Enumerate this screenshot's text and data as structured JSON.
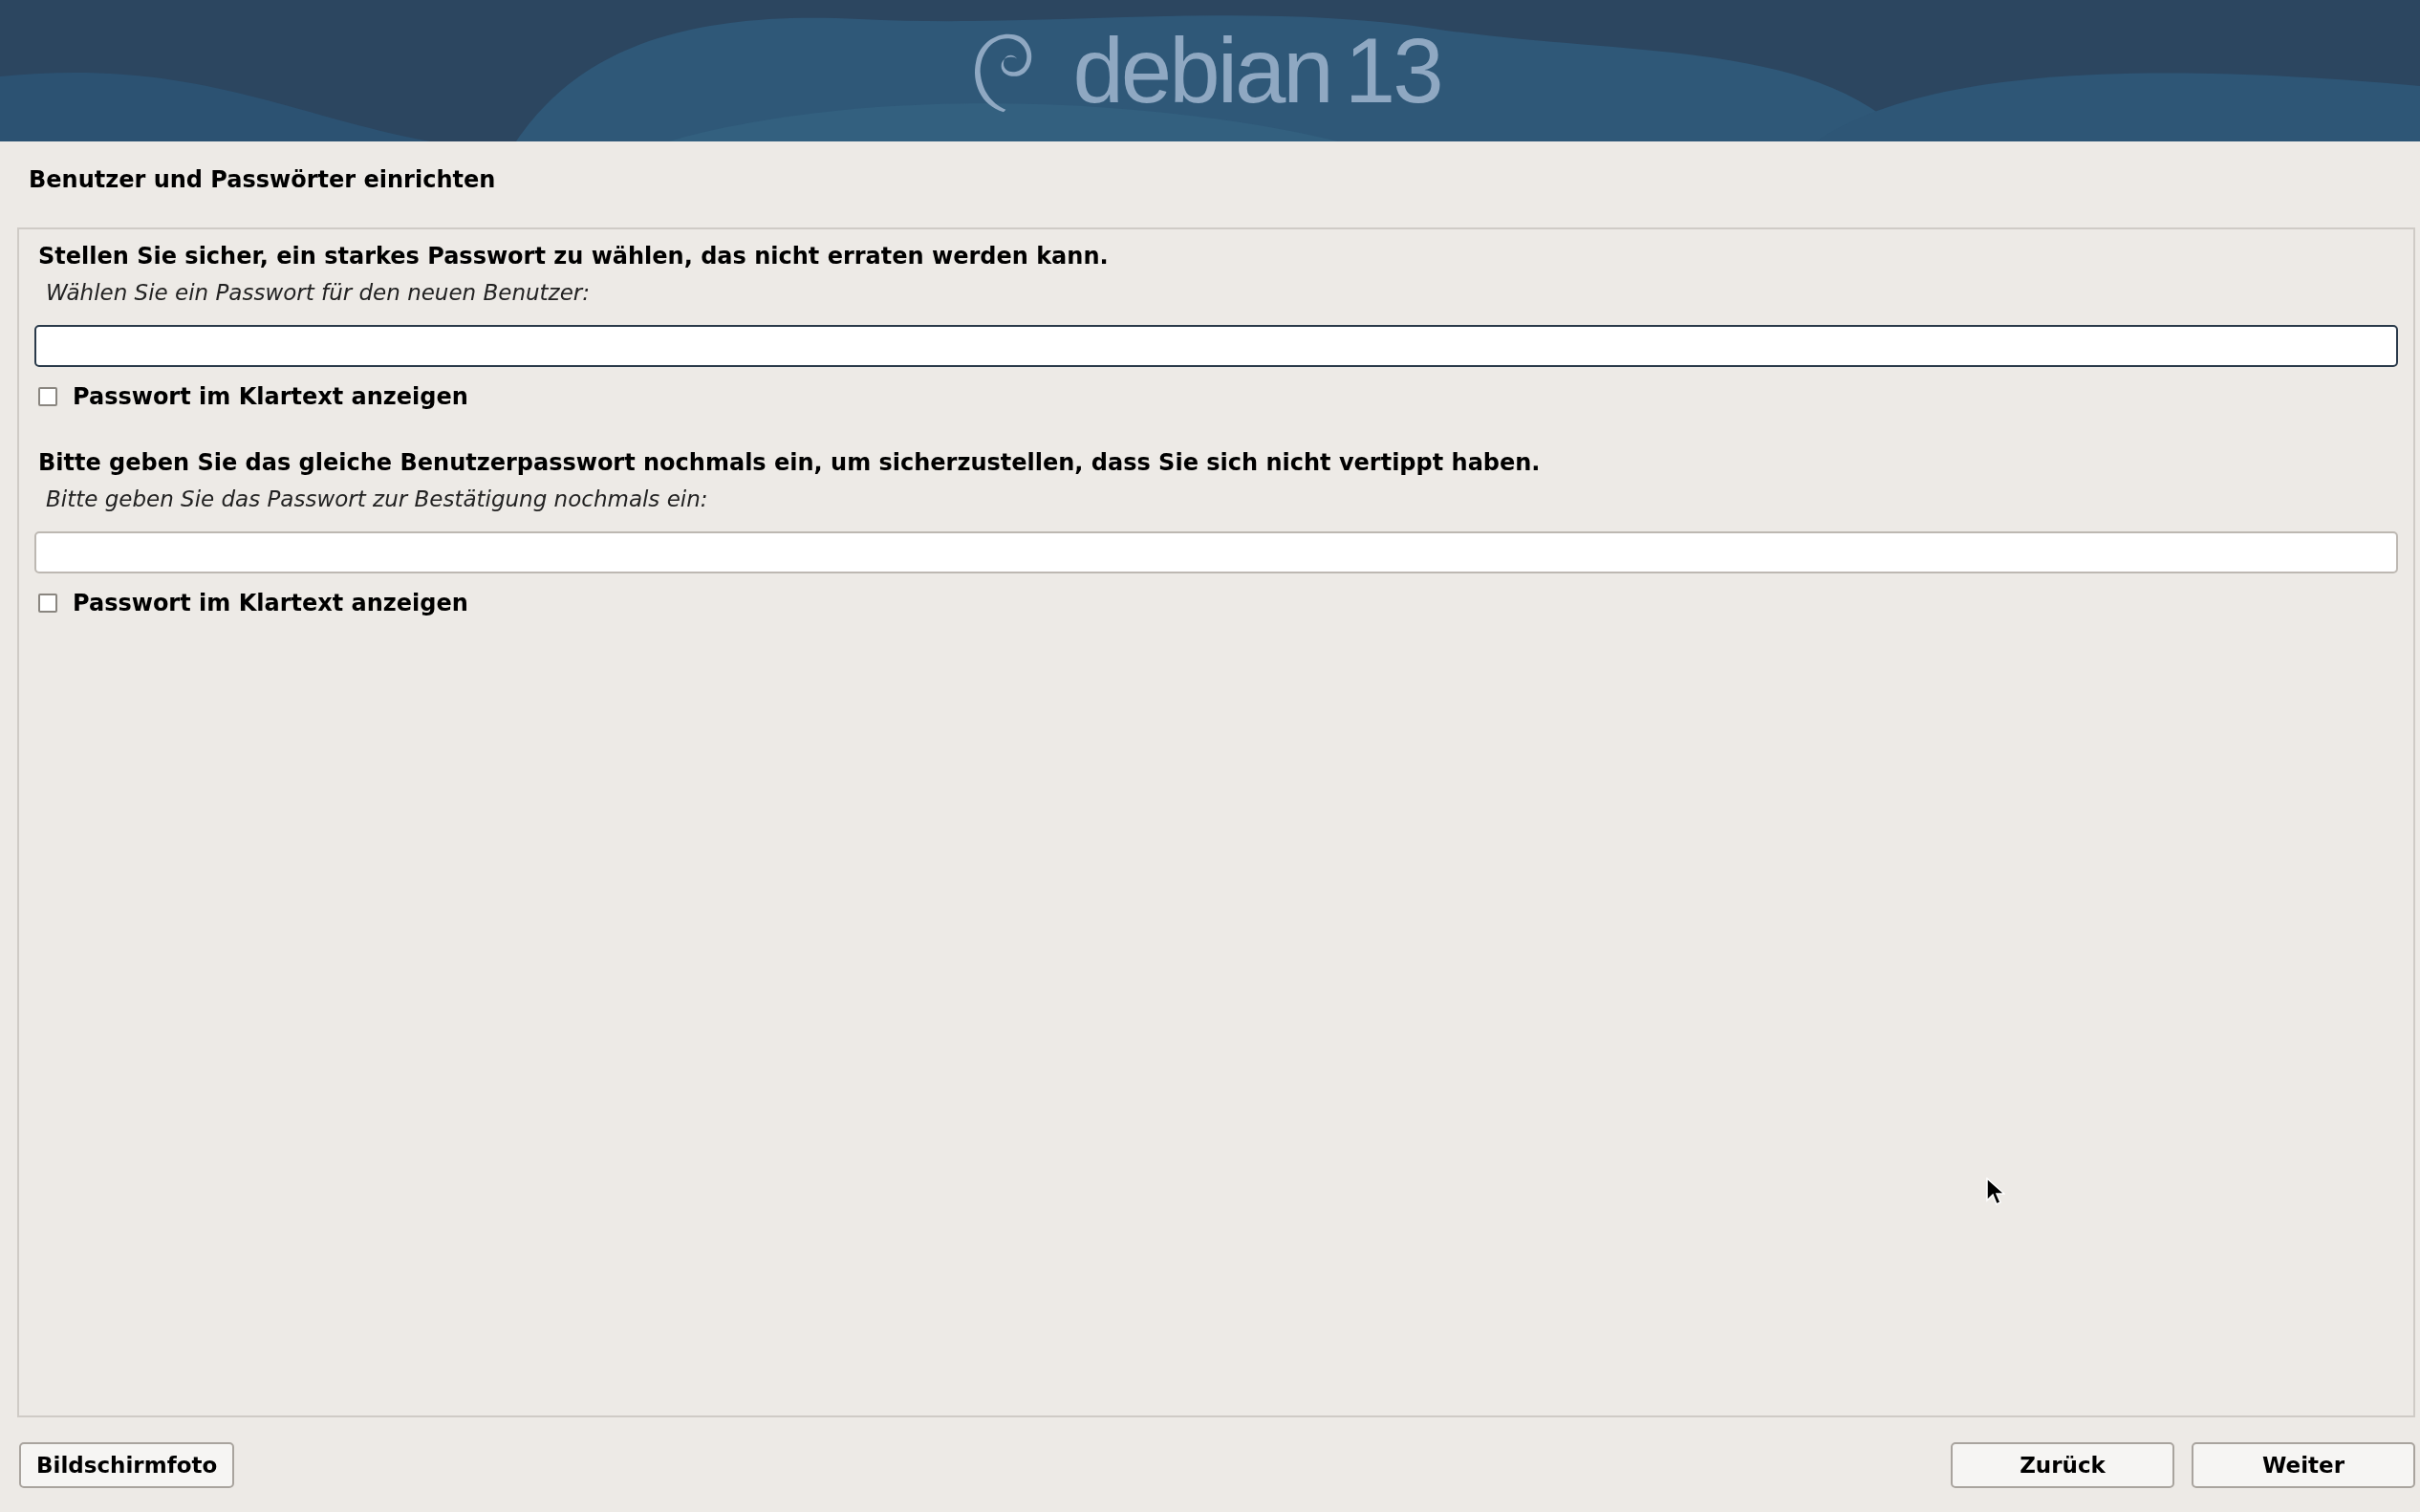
{
  "header": {
    "logo": {
      "wordmark": "debian",
      "version": "13"
    }
  },
  "page_title": "Benutzer und Passwörter einrichten",
  "sections": [
    {
      "prompt": "Stellen Sie sicher, ein starkes Passwort zu wählen, das nicht erraten werden kann.",
      "field_label": "Wählen Sie ein Passwort für den neuen Benutzer:",
      "focused": true,
      "show_password": {
        "label": "Passwort im Klartext anzeigen",
        "checked": false
      }
    },
    {
      "prompt": "Bitte geben Sie das gleiche Benutzerpasswort nochmals ein, um sicherzustellen, dass Sie sich nicht vertippt haben.",
      "field_label": "Bitte geben Sie das Passwort zur Bestätigung nochmals ein:",
      "focused": false,
      "show_password": {
        "label": "Passwort im Klartext anzeigen",
        "checked": false
      }
    }
  ],
  "buttons": {
    "left": [
      {
        "label": "Bildschirmfoto"
      }
    ],
    "right": [
      {
        "label": "Zurück"
      },
      {
        "label": "Weiter"
      }
    ]
  }
}
